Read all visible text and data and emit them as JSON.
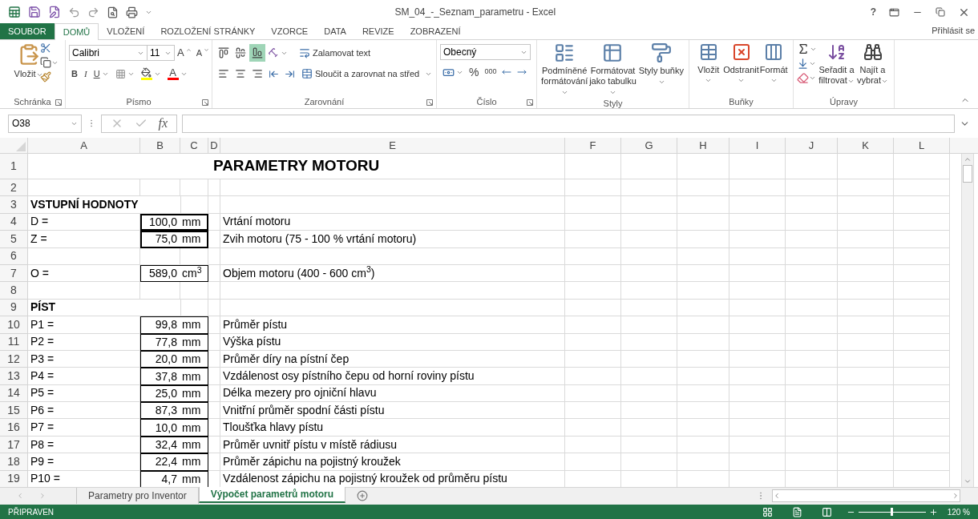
{
  "window": {
    "title": "SM_04_-_Seznam_parametru - Excel",
    "help": "?"
  },
  "menu_tabs": [
    {
      "label": "SOUBOR",
      "kind": "file",
      "selected": false
    },
    {
      "label": "DOMŮ",
      "kind": "tab",
      "selected": true
    },
    {
      "label": "VLOŽENÍ",
      "kind": "tab",
      "selected": false
    },
    {
      "label": "ROZLOŽENÍ STRÁNKY",
      "kind": "tab",
      "selected": false
    },
    {
      "label": "VZORCE",
      "kind": "tab",
      "selected": false
    },
    {
      "label": "DATA",
      "kind": "tab",
      "selected": false
    },
    {
      "label": "REVIZE",
      "kind": "tab",
      "selected": false
    },
    {
      "label": "ZOBRAZENÍ",
      "kind": "tab",
      "selected": false
    }
  ],
  "account": "Přihlásit se",
  "ribbon": {
    "clipboard": {
      "paste": "Vložit",
      "label": "Schránka"
    },
    "font": {
      "name": "Calibri",
      "size": "11",
      "grow": "A",
      "shrink": "A",
      "bold": "B",
      "italic": "I",
      "underline": "U",
      "color_button": "A",
      "label": "Písmo"
    },
    "alignment": {
      "vertical": [
        {
          "selected": false
        },
        {
          "selected": false
        },
        {
          "selected": true
        }
      ],
      "wrap": "Zalamovat text",
      "merge": "Sloučit a zarovnat na střed",
      "label": "Zarovnání"
    },
    "number": {
      "format": "Obecný",
      "percent": "%",
      "thousands": "000",
      "label": "Číslo"
    },
    "styles": {
      "buttons": [
        "Podmíněné formátování",
        "Formátovat jako tabulku",
        "Styly buňky"
      ],
      "label": "Styly"
    },
    "cells": {
      "buttons": [
        "Vložit",
        "Odstranit",
        "Formát"
      ],
      "label": "Buňky"
    },
    "editing": {
      "buttons": [
        "Seřadit a filtrovat",
        "Najít a vybrat"
      ],
      "label": "Úpravy"
    }
  },
  "formula_bar": {
    "name_box": "O38",
    "fx": "fx"
  },
  "columns": [
    "A",
    "B",
    "C",
    "D",
    "E",
    "F",
    "G",
    "H",
    "I",
    "J",
    "K",
    "L"
  ],
  "rows": [
    {
      "number": "1",
      "kind": "title",
      "title": "PARAMETRY MOTORU"
    },
    {
      "number": "2",
      "kind": "empty"
    },
    {
      "number": "3",
      "kind": "section",
      "text": "VSTUPNÍ HODNOTY"
    },
    {
      "number": "4",
      "kind": "param",
      "label": "D =",
      "value": "100,0",
      "unit": "mm",
      "description": "Vrtání motoru",
      "thick_border": true
    },
    {
      "number": "5",
      "kind": "param",
      "label": "Z =",
      "value": "75,0",
      "unit": "mm",
      "description": "Zvih motoru (75 - 100 % vrtání motoru)",
      "thick_border": true
    },
    {
      "number": "6",
      "kind": "empty"
    },
    {
      "number": "7",
      "kind": "param",
      "label": "O =",
      "value": "589,0",
      "unit": "cm$^{3}$",
      "description": "Objem motoru (400 - 600 cm$^{3}$)",
      "thick_border": false
    },
    {
      "number": "8",
      "kind": "empty"
    },
    {
      "number": "9",
      "kind": "section",
      "text": "PÍST"
    },
    {
      "number": "10",
      "kind": "param",
      "label": "P1 =",
      "value": "99,8",
      "unit": "mm",
      "description": "Průměr pístu",
      "thick_border": false
    },
    {
      "number": "11",
      "kind": "param",
      "label": "P2 =",
      "value": "77,8",
      "unit": "mm",
      "description": "Výška pístu",
      "thick_border": false
    },
    {
      "number": "12",
      "kind": "param",
      "label": "P3 =",
      "value": "20,0",
      "unit": "mm",
      "description": "Průměr díry na pístní čep",
      "thick_border": false
    },
    {
      "number": "13",
      "kind": "param",
      "label": "P4 =",
      "value": "37,8",
      "unit": "mm",
      "description": "Vzdálenost osy pístního čepu od horní roviny pístu",
      "thick_border": false
    },
    {
      "number": "14",
      "kind": "param",
      "label": "P5 =",
      "value": "25,0",
      "unit": "mm",
      "description": "Délka mezery pro ojniční hlavu",
      "thick_border": false
    },
    {
      "number": "15",
      "kind": "param",
      "label": "P6 =",
      "value": "87,3",
      "unit": "mm",
      "description": "Vnitřní průměr spodní části pístu",
      "thick_border": false
    },
    {
      "number": "16",
      "kind": "param",
      "label": "P7 =",
      "value": "10,0",
      "unit": "mm",
      "description": "Tloušťka hlavy pístu",
      "thick_border": false
    },
    {
      "number": "17",
      "kind": "param",
      "label": "P8 =",
      "value": "32,4",
      "unit": "mm",
      "description": "Průměr uvnitř pístu v místě rádiusu",
      "thick_border": false
    },
    {
      "number": "18",
      "kind": "param",
      "label": "P9 =",
      "value": "22,4",
      "unit": "mm",
      "description": "Průměr zápichu na pojistný kroužek",
      "thick_border": false
    },
    {
      "number": "19",
      "kind": "param",
      "label": "P10 =",
      "value": "4,7",
      "unit": "mm",
      "description": "Vzdálenost zápichu na pojistný kroužek od průměru pístu",
      "thick_border": false
    }
  ],
  "sheet_tabs": [
    {
      "label": "Parametry pro Inventor",
      "selected": false
    },
    {
      "label": "Výpočet parametrů motoru",
      "selected": true
    }
  ],
  "status_bar": {
    "status": "PŘIPRAVEN",
    "zoom": "120 %",
    "zoom_slider": {
      "level": 0.5
    }
  }
}
